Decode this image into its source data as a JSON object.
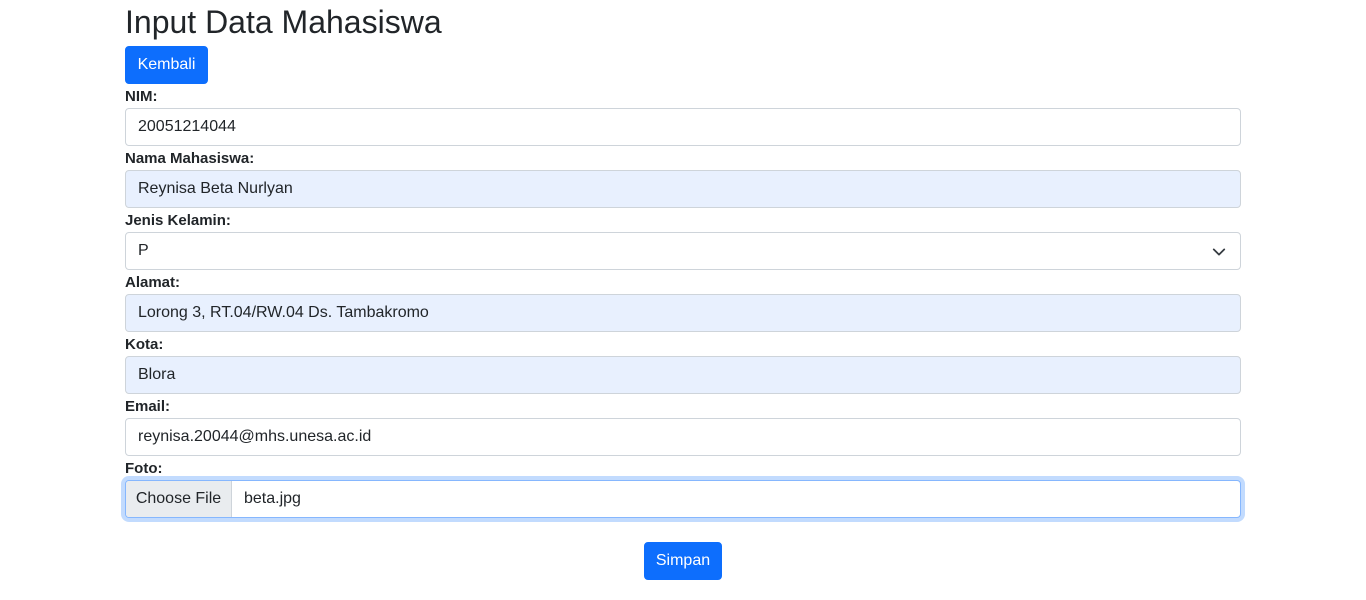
{
  "page": {
    "title": "Input Data Mahasiswa",
    "back_label": "Kembali",
    "save_label": "Simpan"
  },
  "form": {
    "nim": {
      "label": "NIM:",
      "value": "20051214044"
    },
    "nama": {
      "label": "Nama Mahasiswa:",
      "value": "Reynisa Beta Nurlyan"
    },
    "jenis_kelamin": {
      "label": "Jenis Kelamin:",
      "value": "P"
    },
    "alamat": {
      "label": "Alamat:",
      "value": "Lorong 3, RT.04/RW.04 Ds. Tambakromo"
    },
    "kota": {
      "label": "Kota:",
      "value": "Blora"
    },
    "email": {
      "label": "Email:",
      "value": "reynisa.20044@mhs.unesa.ac.id"
    },
    "foto": {
      "label": "Foto:",
      "button_label": "Choose File",
      "file_name": "beta.jpg"
    }
  },
  "colors": {
    "primary": "#0d6efd",
    "autofill_background": "#e8f0fe",
    "border": "#ced4da",
    "text": "#212529"
  },
  "icons": {
    "select_indicator": "chevron-down-icon"
  }
}
